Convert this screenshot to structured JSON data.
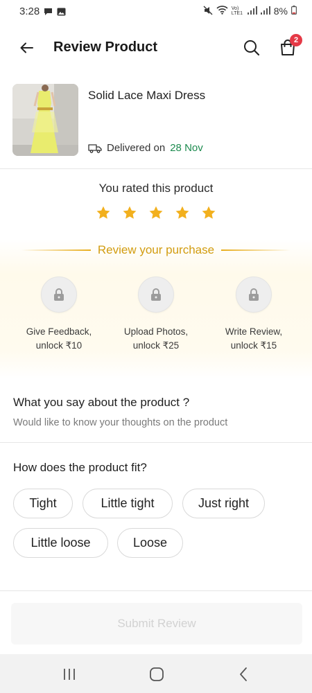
{
  "status_bar": {
    "time": "3:28",
    "signal_label": "Vo) LTE1",
    "battery": "8%"
  },
  "header": {
    "title": "Review Product",
    "cart_count": "2"
  },
  "product": {
    "name": "Solid Lace Maxi Dress",
    "delivered_label": "Delivered on",
    "delivered_date": "28 Nov"
  },
  "rating": {
    "heading": "You rated this product",
    "stars": 5,
    "max_stars": 5,
    "star_color": "#f2b01e"
  },
  "purchase": {
    "title": "Review your purchase",
    "items": [
      {
        "line1": "Give Feedback,",
        "line2": "unlock ₹10"
      },
      {
        "line1": "Upload Photos,",
        "line2": "unlock ₹25"
      },
      {
        "line1": "Write Review,",
        "line2": "unlock ₹15"
      }
    ]
  },
  "say": {
    "title": "What you say about the product ?",
    "subtitle": "Would like to know your thoughts on the product"
  },
  "fit": {
    "title": "How does the product fit?",
    "options": [
      "Tight",
      "Little tight",
      "Just right",
      "Little loose",
      "Loose"
    ]
  },
  "submit": {
    "label": "Submit Review"
  },
  "colors": {
    "accent_gold": "#d29c10",
    "delivered_green": "#1d8b4f",
    "badge_red": "#e53946"
  }
}
